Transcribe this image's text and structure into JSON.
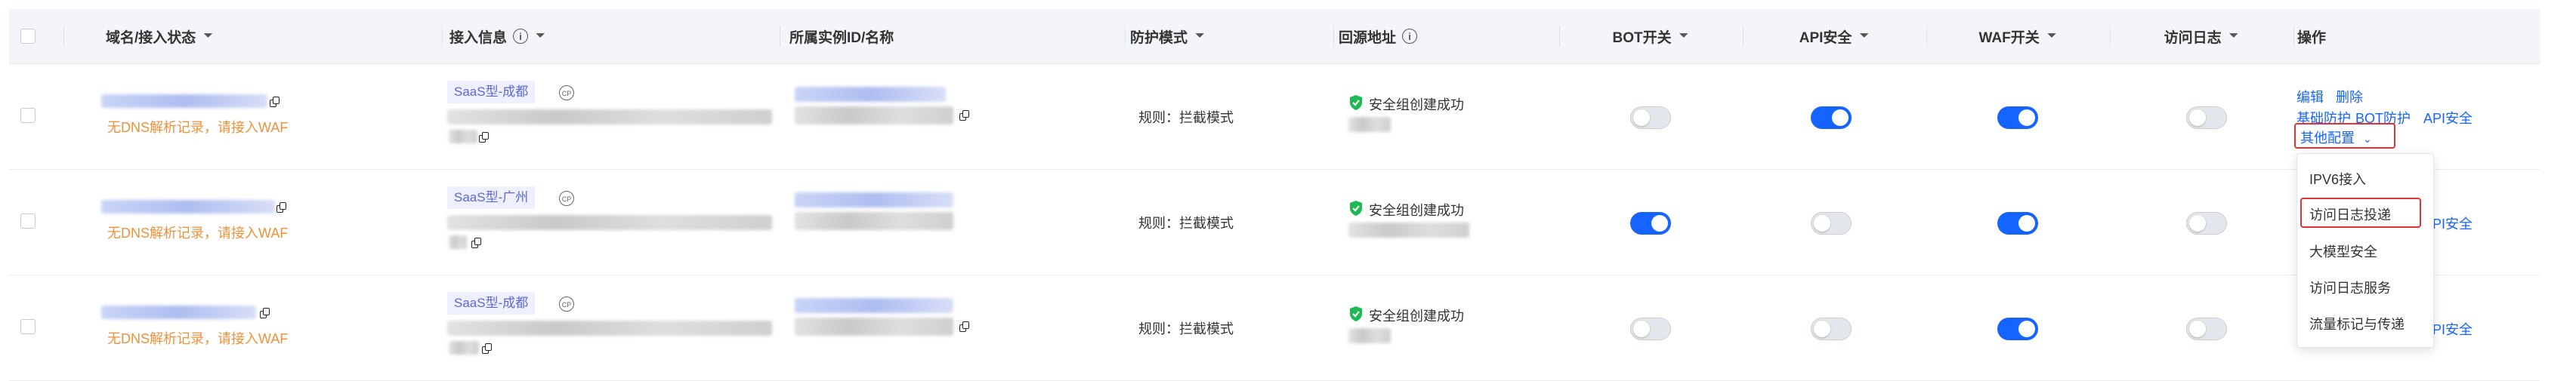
{
  "headers": {
    "domain": "域名/接入状态",
    "access": "接入信息",
    "instance": "所属实例ID/名称",
    "protect": "防护模式",
    "origin": "回源地址",
    "bot": "BOT开关",
    "api": "API安全",
    "waf": "WAF开关",
    "log": "访问日志",
    "ops": "操作"
  },
  "rows": [
    {
      "status": "无DNS解析记录，请接入WAF",
      "tag": "SaaS型-成都",
      "mode": "规则：拦截模式",
      "origin_status": "安全组创建成功",
      "bot": false,
      "api": true,
      "waf": true,
      "log": false
    },
    {
      "status": "无DNS解析记录，请接入WAF",
      "tag": "SaaS型-广州",
      "mode": "规则：拦截模式",
      "origin_status": "安全组创建成功",
      "bot": true,
      "api": false,
      "waf": true,
      "log": false
    },
    {
      "status": "无DNS解析记录，请接入WAF",
      "tag": "SaaS型-成都",
      "mode": "规则：拦截模式",
      "origin_status": "安全组创建成功",
      "bot": false,
      "api": false,
      "waf": true,
      "log": false
    }
  ],
  "ops": {
    "edit": "编辑",
    "delete": "删除",
    "basic": "基础防护",
    "botprotect": "BOT防护",
    "apisec": "API安全",
    "more": "其他配置",
    "partial_api2": "API安全",
    "partial_api3": "API安全"
  },
  "menu": {
    "items": [
      "IPV6接入",
      "访问日志投递",
      "大模型安全",
      "访问日志服务",
      "流量标记与传递"
    ]
  },
  "colors": {
    "accent": "#1664ff",
    "warning": "#f0913a",
    "highlight": "#e23232",
    "tag_bg": "#eef0fd"
  }
}
